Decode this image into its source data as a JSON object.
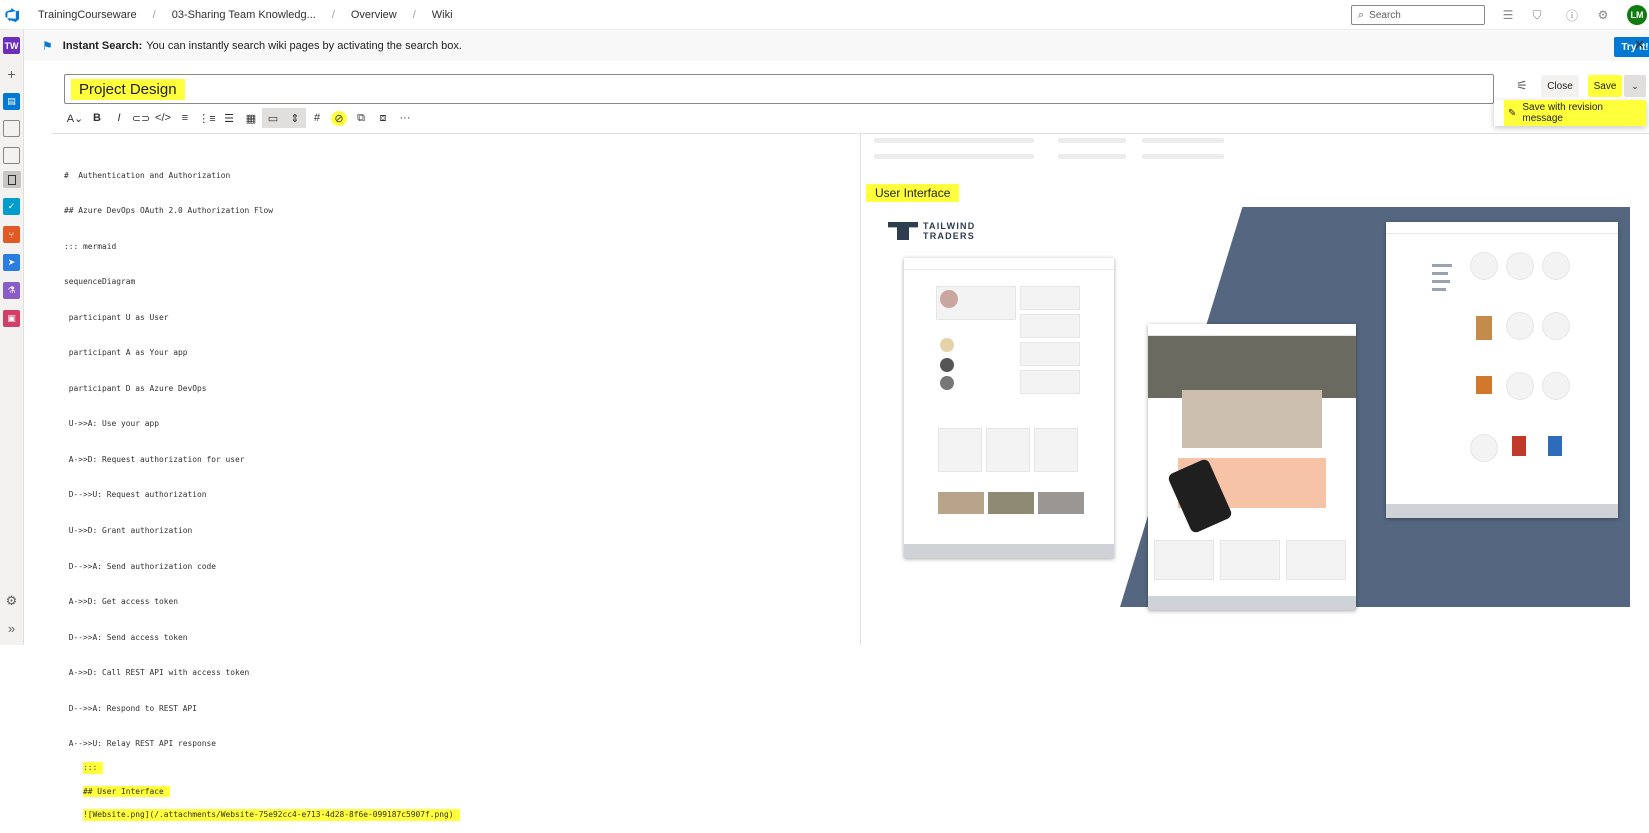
{
  "breadcrumbs": [
    "TrainingCourseware",
    "03-Sharing Team Knowledg...",
    "Overview",
    "Wiki"
  ],
  "search": {
    "placeholder": "Search"
  },
  "user": {
    "initials": "LM"
  },
  "rail": {
    "project_initials": "TW"
  },
  "infobar": {
    "label": "Instant Search:",
    "message": "You can instantly search wiki pages by activating the search box.",
    "try_label": "Try it!"
  },
  "page": {
    "title": "Project Design"
  },
  "actions": {
    "close_label": "Close",
    "save_label": "Save",
    "save_revision_label": "Save with revision message"
  },
  "editor_lines": [
    "#  Authentication and Authorization",
    "## Azure DevOps OAuth 2.0 Authorization Flow",
    "::: mermaid",
    "sequenceDiagram",
    " participant U as User",
    " participant A as Your app",
    " participant D as Azure DevOps",
    " U->>A: Use your app",
    " A->>D: Request authorization for user",
    " D-->>U: Request authorization",
    " U->>D: Grant authorization",
    " D-->>A: Send authorization code",
    " A->>D: Get access token",
    " D-->>A: Send access token",
    " A->>D: Call REST API with access token",
    " D-->>A: Respond to REST API",
    " A-->>U: Relay REST API response",
    ":::",
    "## User Interface",
    "![Website.png](/.attachments/Website-75e92cc4-e713-4d28-8f6e-099187c5907f.png)"
  ],
  "preview": {
    "heading": "User Interface",
    "brand_line1": "TAILWIND",
    "brand_line2": "TRADERS"
  }
}
